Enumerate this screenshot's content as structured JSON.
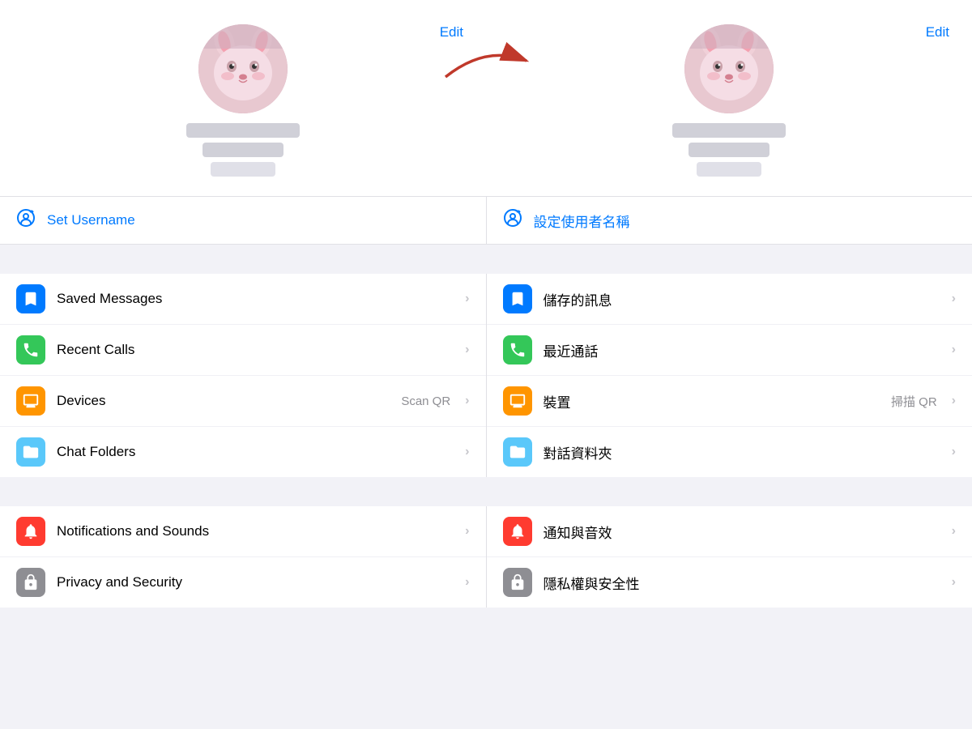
{
  "left": {
    "edit": "Edit",
    "username_label": "Set Username",
    "menu_items": [
      {
        "icon": "bookmark",
        "icon_color": "icon-blue",
        "label": "Saved Messages",
        "badge": "",
        "chevron": "›"
      },
      {
        "icon": "phone",
        "icon_color": "icon-green",
        "label": "Recent Calls",
        "badge": "",
        "chevron": "›"
      },
      {
        "icon": "monitor",
        "icon_color": "icon-orange",
        "label": "Devices",
        "badge": "Scan QR",
        "chevron": "›"
      },
      {
        "icon": "folder",
        "icon_color": "icon-teal",
        "label": "Chat Folders",
        "badge": "",
        "chevron": "›"
      }
    ],
    "menu_items2": [
      {
        "icon": "bell",
        "icon_color": "icon-red",
        "label": "Notifications and Sounds",
        "badge": "",
        "chevron": "›"
      },
      {
        "icon": "lock",
        "icon_color": "icon-gray",
        "label": "Privacy and Security",
        "badge": "",
        "chevron": "›"
      }
    ]
  },
  "right": {
    "edit": "Edit",
    "username_label": "設定使用者名稱",
    "menu_items": [
      {
        "icon": "bookmark",
        "icon_color": "icon-blue",
        "label": "儲存的訊息",
        "badge": "",
        "chevron": "›"
      },
      {
        "icon": "phone",
        "icon_color": "icon-green",
        "label": "最近通話",
        "badge": "",
        "chevron": "›"
      },
      {
        "icon": "monitor",
        "icon_color": "icon-orange",
        "label": "裝置",
        "badge": "掃描 QR",
        "chevron": "›"
      },
      {
        "icon": "folder",
        "icon_color": "icon-teal",
        "label": "對話資料夾",
        "badge": "",
        "chevron": "›"
      }
    ],
    "menu_items2": [
      {
        "icon": "bell",
        "icon_color": "icon-red",
        "label": "通知與音效",
        "badge": "",
        "chevron": "›"
      },
      {
        "icon": "lock",
        "icon_color": "icon-gray",
        "label": "隱私權與安全性",
        "badge": "",
        "chevron": "›"
      }
    ]
  }
}
